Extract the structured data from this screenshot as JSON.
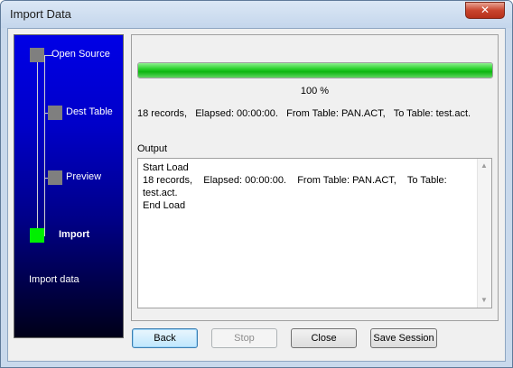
{
  "window": {
    "title": "Import Data",
    "close_glyph": "✕"
  },
  "wizard": {
    "steps": [
      {
        "label": "Open Source",
        "state": "done"
      },
      {
        "label": "Dest Table",
        "state": "done"
      },
      {
        "label": "Preview",
        "state": "done"
      },
      {
        "label": "Import",
        "state": "current"
      }
    ],
    "description": "Import data"
  },
  "progress": {
    "value_percent": 100,
    "label": "100 %"
  },
  "status_line": "18 records,   Elapsed: 00:00:00.   From Table: PAN.ACT,   To Table: test.act.",
  "output": {
    "label": "Output",
    "text": "Start Load\n18 records,    Elapsed: 00:00:00.    From Table: PAN.ACT,    To Table:\ntest.act.\nEnd Load"
  },
  "buttons": {
    "back": "Back",
    "stop": "Stop",
    "close": "Close",
    "save_session": "Save Session"
  },
  "colors": {
    "progress_fill": "#1ec821",
    "active_step": "#00f000",
    "inactive_step": "#7f7f7f",
    "panel_top": "#0000e6",
    "panel_bottom": "#000018"
  }
}
